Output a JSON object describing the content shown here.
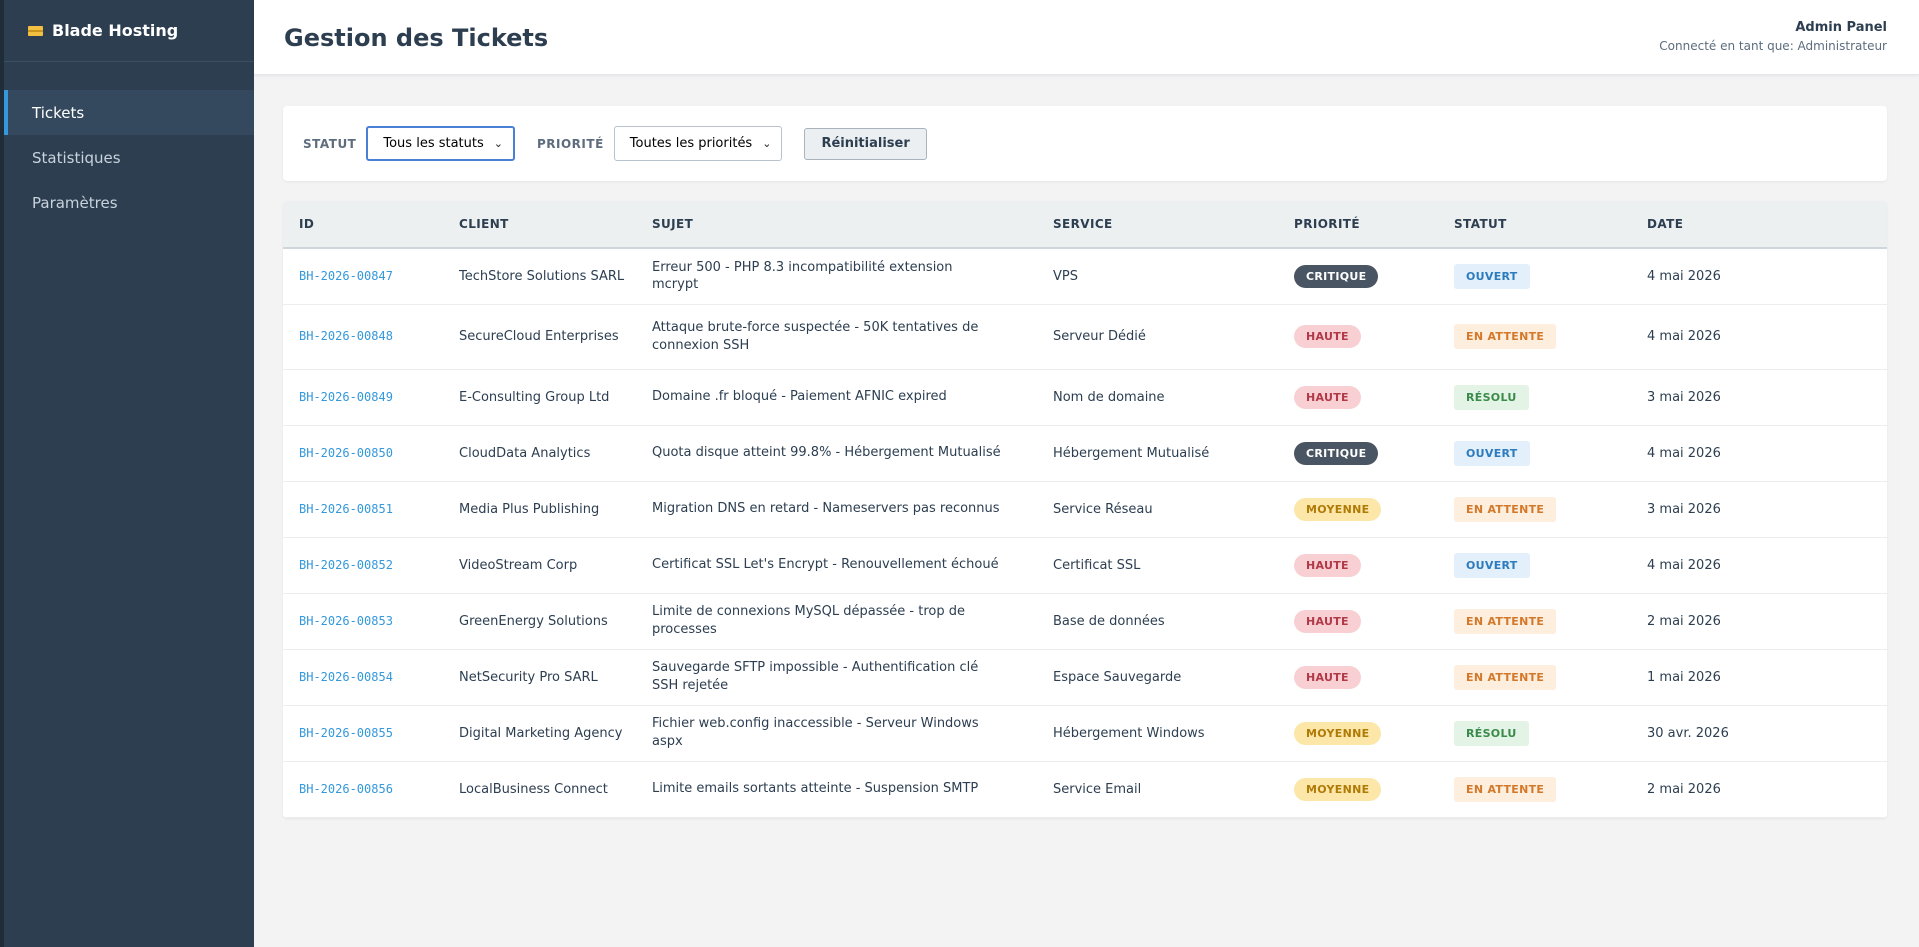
{
  "sidebar": {
    "brand": "Blade Hosting",
    "items": [
      {
        "label": "Tickets",
        "active": true
      },
      {
        "label": "Statistiques",
        "active": false
      },
      {
        "label": "Paramètres",
        "active": false
      }
    ]
  },
  "header": {
    "title": "Gestion des Tickets",
    "admin_title": "Admin Panel",
    "admin_sub": "Connecté en tant que: Administrateur"
  },
  "filters": {
    "status_label": "STATUT",
    "status_value": "Tous les statuts",
    "priority_label": "PRIORITÉ",
    "priority_value": "Toutes les priorités",
    "reset_label": "Réinitialiser"
  },
  "table": {
    "columns": [
      "ID",
      "CLIENT",
      "SUJET",
      "SERVICE",
      "PRIORITÉ",
      "STATUT",
      "DATE"
    ],
    "rows": [
      {
        "id": "BH-2026-00847",
        "client": "TechStore Solutions SARL",
        "subject": "Erreur 500 - PHP 8.3 incompatibilité extension mcrypt",
        "service": "VPS",
        "priority": "CRITIQUE",
        "status": "OUVERT",
        "date": "4 mai 2026"
      },
      {
        "id": "BH-2026-00848",
        "client": "SecureCloud Enterprises",
        "subject": "Attaque brute-force suspectée - 50K tentatives de connexion SSH",
        "service": "Serveur Dédié",
        "priority": "HAUTE",
        "status": "EN ATTENTE",
        "date": "4 mai 2026"
      },
      {
        "id": "BH-2026-00849",
        "client": "E-Consulting Group Ltd",
        "subject": "Domaine .fr bloqué - Paiement AFNIC expired",
        "service": "Nom de domaine",
        "priority": "HAUTE",
        "status": "RÉSOLU",
        "date": "3 mai 2026"
      },
      {
        "id": "BH-2026-00850",
        "client": "CloudData Analytics",
        "subject": "Quota disque atteint 99.8% - Hébergement Mutualisé",
        "service": "Hébergement Mutualisé",
        "priority": "CRITIQUE",
        "status": "OUVERT",
        "date": "4 mai 2026"
      },
      {
        "id": "BH-2026-00851",
        "client": "Media Plus Publishing",
        "subject": "Migration DNS en retard - Nameservers pas reconnus",
        "service": "Service Réseau",
        "priority": "MOYENNE",
        "status": "EN ATTENTE",
        "date": "3 mai 2026"
      },
      {
        "id": "BH-2026-00852",
        "client": "VideoStream Corp",
        "subject": "Certificat SSL Let's Encrypt - Renouvellement échoué",
        "service": "Certificat SSL",
        "priority": "HAUTE",
        "status": "OUVERT",
        "date": "4 mai 2026"
      },
      {
        "id": "BH-2026-00853",
        "client": "GreenEnergy Solutions",
        "subject": "Limite de connexions MySQL dépassée - trop de processes",
        "service": "Base de données",
        "priority": "HAUTE",
        "status": "EN ATTENTE",
        "date": "2 mai 2026"
      },
      {
        "id": "BH-2026-00854",
        "client": "NetSecurity Pro SARL",
        "subject": "Sauvegarde SFTP impossible - Authentification clé SSH rejetée",
        "service": "Espace Sauvegarde",
        "priority": "HAUTE",
        "status": "EN ATTENTE",
        "date": "1 mai 2026"
      },
      {
        "id": "BH-2026-00855",
        "client": "Digital Marketing Agency",
        "subject": "Fichier web.config inaccessible - Serveur Windows aspx",
        "service": "Hébergement Windows",
        "priority": "MOYENNE",
        "status": "RÉSOLU",
        "date": "30 avr. 2026"
      },
      {
        "id": "BH-2026-00856",
        "client": "LocalBusiness Connect",
        "subject": "Limite emails sortants atteinte - Suspension SMTP",
        "service": "Service Email",
        "priority": "MOYENNE",
        "status": "EN ATTENTE",
        "date": "2 mai 2026"
      }
    ]
  }
}
